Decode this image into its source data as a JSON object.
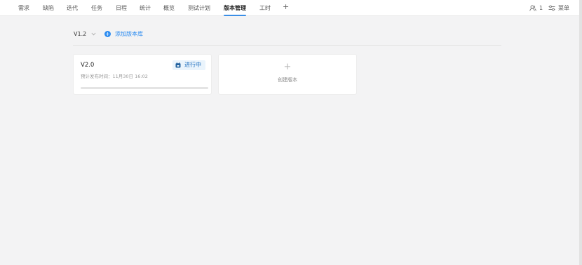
{
  "nav": {
    "tabs": [
      {
        "label": "需求"
      },
      {
        "label": "缺陷"
      },
      {
        "label": "迭代"
      },
      {
        "label": "任务"
      },
      {
        "label": "日程"
      },
      {
        "label": "统计"
      },
      {
        "label": "概览"
      },
      {
        "label": "测试计划"
      },
      {
        "label": "版本管理"
      },
      {
        "label": "工时"
      }
    ],
    "active_tab": "版本管理",
    "add_tab_label": "+",
    "member_count": "1",
    "menu_label": "菜单",
    "icons": {
      "member": "user-group-icon",
      "menu": "sliders-icon"
    }
  },
  "toolbar": {
    "version_selector": "V1.2",
    "add_library_label": "添加版本库",
    "accent_color": "#2d8cf0"
  },
  "version_card": {
    "name": "V2.0",
    "status": "进行中",
    "status_icon": "calendar-icon",
    "release_label": "预计发布时间：",
    "release_date": "11月30日 16:02",
    "progress": 0
  },
  "create_card": {
    "plus": "+",
    "label": "创建版本"
  }
}
